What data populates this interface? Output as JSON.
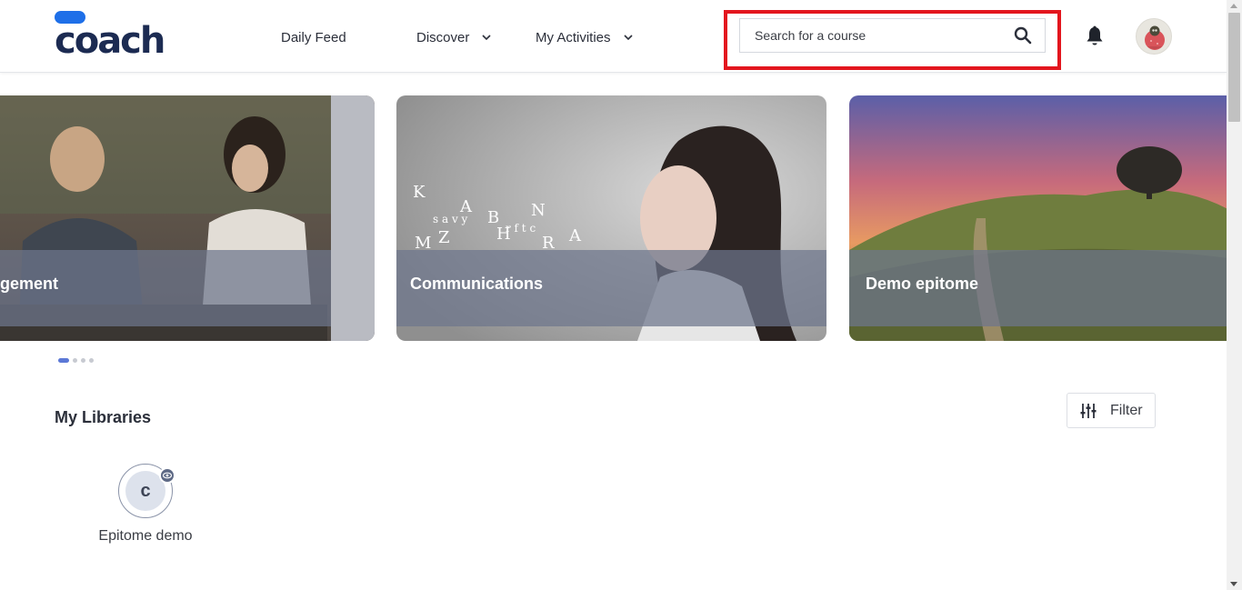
{
  "header": {
    "logo_text": "coach",
    "nav": [
      {
        "label": "Daily Feed"
      },
      {
        "label": "Discover"
      },
      {
        "label": "My Activities"
      }
    ],
    "search": {
      "placeholder": "Search for a course",
      "value": ""
    },
    "icons": {
      "search": "search-icon",
      "bell": "bell-icon",
      "avatar": "user-avatar",
      "chevron": "chevron-down-icon"
    }
  },
  "carousel": {
    "cards": [
      {
        "title": "gement"
      },
      {
        "title": "Communications"
      },
      {
        "title": "Demo epitome"
      }
    ],
    "dot_count": 4,
    "active_dot": 0
  },
  "libraries": {
    "title": "My Libraries",
    "filter_label": "Filter",
    "items": [
      {
        "initial": "c",
        "name": "Epitome demo",
        "visibility_icon": "eye-icon"
      }
    ]
  },
  "colors": {
    "brand": "#1e6fe8",
    "brand_dark": "#1c2b52",
    "highlight": "#e3161e",
    "active_dot": "#5b78d6"
  }
}
